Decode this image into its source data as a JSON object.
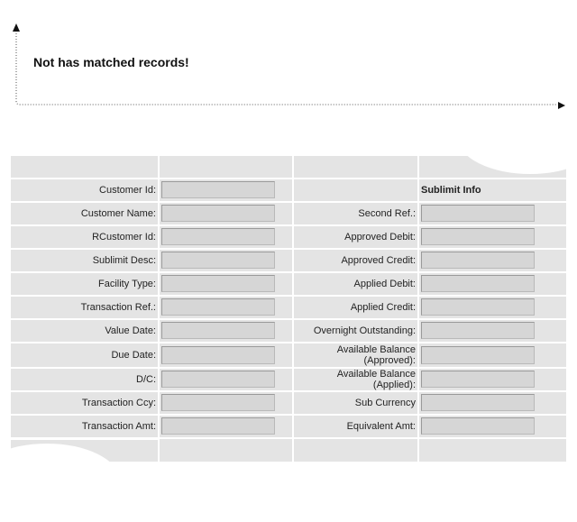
{
  "result": {
    "message": "Not has matched records!"
  },
  "form": {
    "section_title": "Sublimit Info",
    "left_fields": [
      {
        "label": "Customer Id:",
        "value": ""
      },
      {
        "label": "Customer Name:",
        "value": ""
      },
      {
        "label": "RCustomer Id:",
        "value": ""
      },
      {
        "label": "Sublimit Desc:",
        "value": ""
      },
      {
        "label": "Facility Type:",
        "value": ""
      },
      {
        "label": "Transaction Ref.:",
        "value": ""
      },
      {
        "label": "Value Date:",
        "value": ""
      },
      {
        "label": "Due Date:",
        "value": ""
      },
      {
        "label": "D/C:",
        "value": ""
      },
      {
        "label": "Transaction Ccy:",
        "value": ""
      },
      {
        "label": "Transaction Amt:",
        "value": ""
      }
    ],
    "right_fields": [
      {
        "label": "Second Ref.:",
        "value": ""
      },
      {
        "label": "Approved Debit:",
        "value": ""
      },
      {
        "label": "Approved Credit:",
        "value": ""
      },
      {
        "label": "Applied Debit:",
        "value": ""
      },
      {
        "label": "Applied Credit:",
        "value": ""
      },
      {
        "label": "Overnight Outstanding:",
        "value": ""
      },
      {
        "label": "Available Balance (Approved):",
        "value": ""
      },
      {
        "label": "Available Balance (Applied):",
        "value": ""
      },
      {
        "label": "Sub Currency",
        "value": ""
      },
      {
        "label": "Equivalent Amt:",
        "value": ""
      }
    ]
  }
}
